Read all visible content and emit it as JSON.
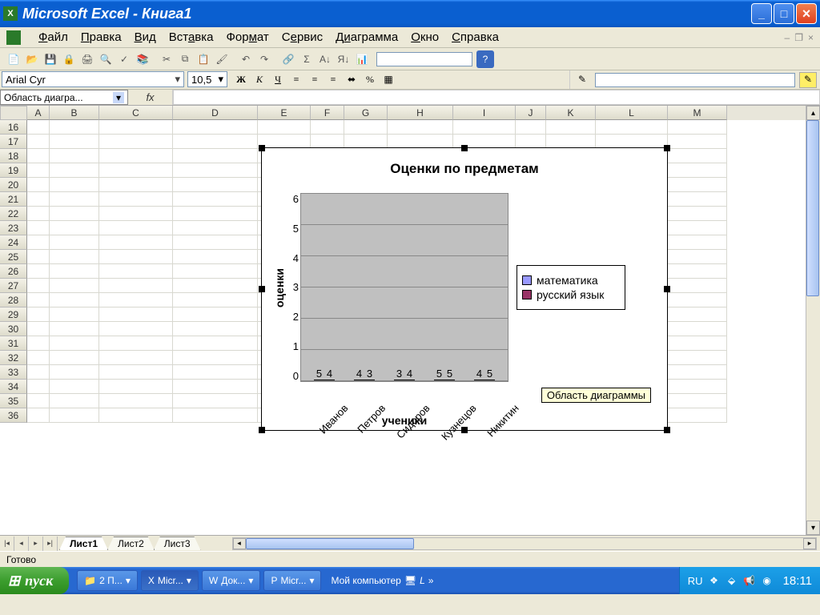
{
  "titlebar": {
    "text": "Microsoft Excel - Книга1"
  },
  "menus": {
    "file": "Файл",
    "edit": "Правка",
    "view": "Вид",
    "insert": "Вставка",
    "format": "Формат",
    "service": "Сервис",
    "diagram": "Диаграмма",
    "window": "Окно",
    "help": "Справка"
  },
  "formatbar": {
    "font": "Arial Cyr",
    "size": "10,5",
    "bold": "Ж",
    "italic": "К",
    "underline": "Ч",
    "currency": "%",
    "autosum": "Σ"
  },
  "namebox": {
    "value": "Область диагра..."
  },
  "fx": "fx",
  "cols": {
    "labels": [
      "A",
      "B",
      "C",
      "D",
      "E",
      "F",
      "G",
      "H",
      "I",
      "J",
      "K",
      "L",
      "M"
    ],
    "widths": [
      28,
      62,
      92,
      106,
      66,
      42,
      54,
      82,
      78,
      38,
      62,
      90,
      74
    ]
  },
  "rows": {
    "start": 16,
    "end": 36
  },
  "chart_data": {
    "type": "bar",
    "title": "Оценки по предметам",
    "xlabel": "ученики",
    "ylabel": "оценки",
    "ylim": [
      0,
      6
    ],
    "yticks": [
      0,
      1,
      2,
      3,
      4,
      5,
      6
    ],
    "categories": [
      "Иванов",
      "Петров",
      "Сидоров",
      "Кузнецов",
      "Никитин"
    ],
    "series": [
      {
        "name": "математика",
        "values": [
          5,
          4,
          3,
          5,
          4
        ],
        "color": "#9999ff"
      },
      {
        "name": "русский язык",
        "values": [
          4,
          3,
          4,
          5,
          5
        ],
        "color": "#993366"
      }
    ],
    "tooltip": "Область диаграммы"
  },
  "tabs": {
    "t1": "Лист1",
    "t2": "Лист2",
    "t3": "Лист3"
  },
  "status": {
    "ready": "Готово"
  },
  "taskbar": {
    "start": "пуск",
    "items": [
      {
        "icon": "📁",
        "label": "2 П..."
      },
      {
        "icon": "X",
        "label": "Micr..."
      },
      {
        "icon": "W",
        "label": "Док..."
      },
      {
        "icon": "P",
        "label": "Micr..."
      }
    ],
    "mycomp": "Мой компьютер",
    "lang": "RU",
    "clock": "18:11"
  }
}
